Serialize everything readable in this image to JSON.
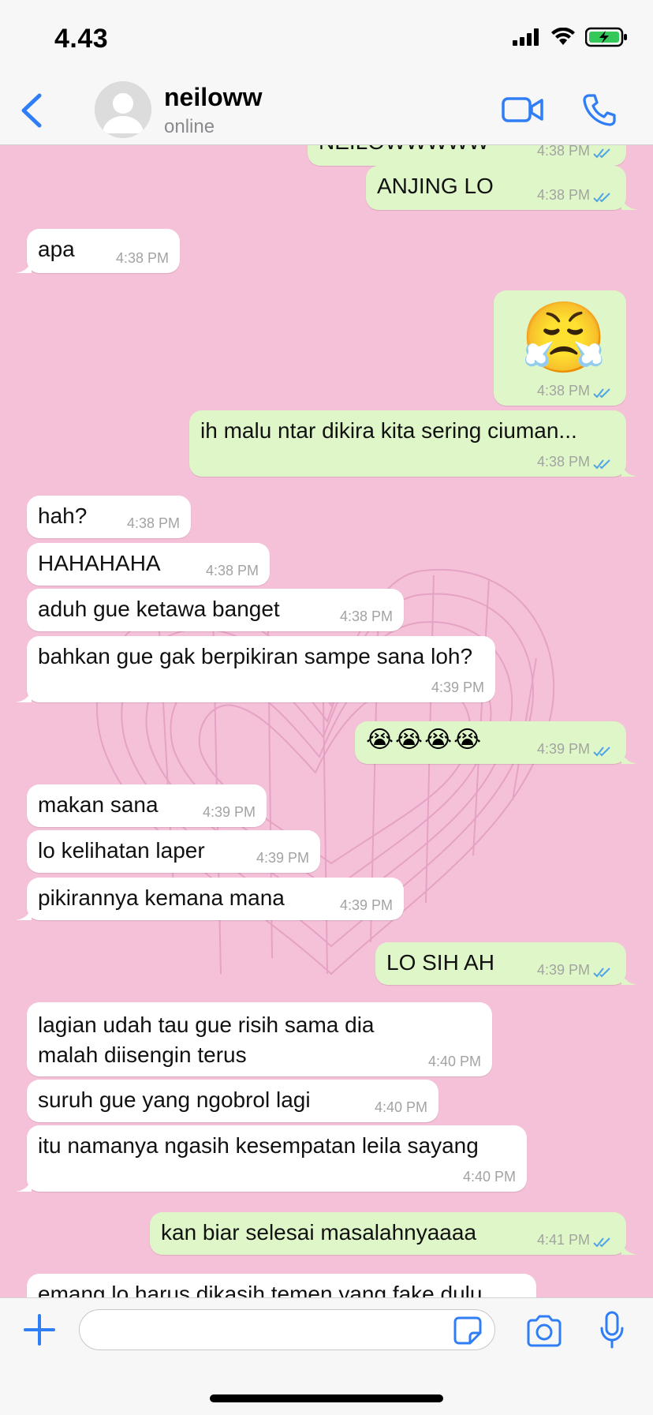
{
  "status_bar": {
    "time": "4.43"
  },
  "header": {
    "contact_name": "neiloww",
    "contact_status": "online"
  },
  "messages": [
    {
      "dir": "out",
      "text": "NEILOWWWWW",
      "time": "4:38 PM"
    },
    {
      "dir": "out",
      "text": "ANJING LO",
      "time": "4:38 PM"
    },
    {
      "dir": "in",
      "text": "apa",
      "time": "4:38 PM"
    },
    {
      "dir": "out",
      "text": "😤",
      "time": "4:38 PM"
    },
    {
      "dir": "out",
      "text": "ih malu ntar dikira kita sering ciuman...",
      "time": "4:38 PM"
    },
    {
      "dir": "in",
      "text": "hah?",
      "time": "4:38 PM"
    },
    {
      "dir": "in",
      "text": "HAHAHAHA",
      "time": "4:38 PM"
    },
    {
      "dir": "in",
      "text": "aduh gue ketawa banget",
      "time": "4:38 PM"
    },
    {
      "dir": "in",
      "text": "bahkan gue gak berpikiran sampe sana loh?",
      "time": "4:39 PM"
    },
    {
      "dir": "out",
      "text": "😭😭😭😭",
      "time": "4:39 PM"
    },
    {
      "dir": "in",
      "text": "makan sana",
      "time": "4:39 PM"
    },
    {
      "dir": "in",
      "text": "lo kelihatan laper",
      "time": "4:39 PM"
    },
    {
      "dir": "in",
      "text": "pikirannya kemana mana",
      "time": "4:39 PM"
    },
    {
      "dir": "out",
      "text": "LO SIH AH",
      "time": "4:39 PM"
    },
    {
      "dir": "in",
      "text": "lagian udah tau gue risih sama dia malah diisengin terus",
      "time": "4:40 PM"
    },
    {
      "dir": "in",
      "text": "suruh gue yang ngobrol lagi",
      "time": "4:40 PM"
    },
    {
      "dir": "in",
      "text": "itu namanya ngasih kesempatan leila sayang",
      "time": "4:40 PM"
    },
    {
      "dir": "out",
      "text": "kan biar selesai masalahnyaaaa",
      "time": "4:41 PM"
    },
    {
      "dir": "in",
      "text": "emang lo harus dikasih temen yang fake dulu",
      "time": ""
    }
  ],
  "composer": {
    "placeholder": ""
  },
  "icons": {
    "back": "chevron-left-icon",
    "video": "video-camera-icon",
    "call": "phone-icon",
    "plus": "plus-icon",
    "sticker": "sticker-icon",
    "camera": "camera-icon",
    "mic": "microphone-icon"
  },
  "colors": {
    "accent": "#2f7ef6",
    "chat_bg": "#f5c1d9",
    "outgoing_bubble": "#dff7c8",
    "incoming_bubble": "#ffffff",
    "read_ticks": "#4fa3e8"
  }
}
